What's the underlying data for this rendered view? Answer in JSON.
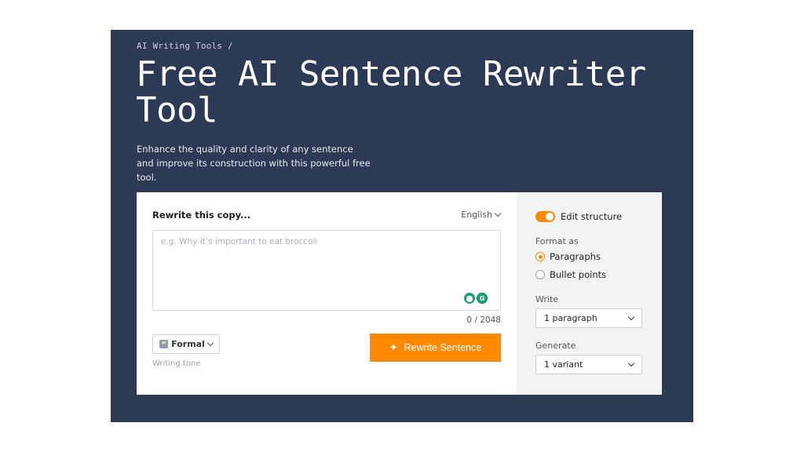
{
  "breadcrumb": "AI Writing Tools /",
  "title": "Free AI Sentence Rewriter Tool",
  "subtitle": "Enhance the quality and clarity of any sentence and improve its construction with this powerful free tool.",
  "editor": {
    "label": "Rewrite this copy...",
    "language": "English",
    "placeholder": "e.g. Why it’s important to eat broccoli",
    "value": "",
    "counter": "0 / 2048",
    "tone_button": "Formal",
    "tone_caption": "Writing tone",
    "submit_label": "Rewrite Sentence"
  },
  "options": {
    "edit_structure_label": "Edit structure",
    "edit_structure_on": true,
    "format_label": "Format as",
    "format_options": [
      "Paragraphs",
      "Bullet points"
    ],
    "format_selected": "Paragraphs",
    "write_label": "Write",
    "write_value": "1 paragraph",
    "generate_label": "Generate",
    "generate_value": "1 variant"
  },
  "colors": {
    "hero_bg": "#2d3a55",
    "accent": "#ff8a00",
    "panel_bg": "#f2f3f5"
  },
  "icons": [
    "chevron-down-icon",
    "sparkle-icon",
    "tone-icon",
    "grammarly-icon",
    "location-icon"
  ]
}
